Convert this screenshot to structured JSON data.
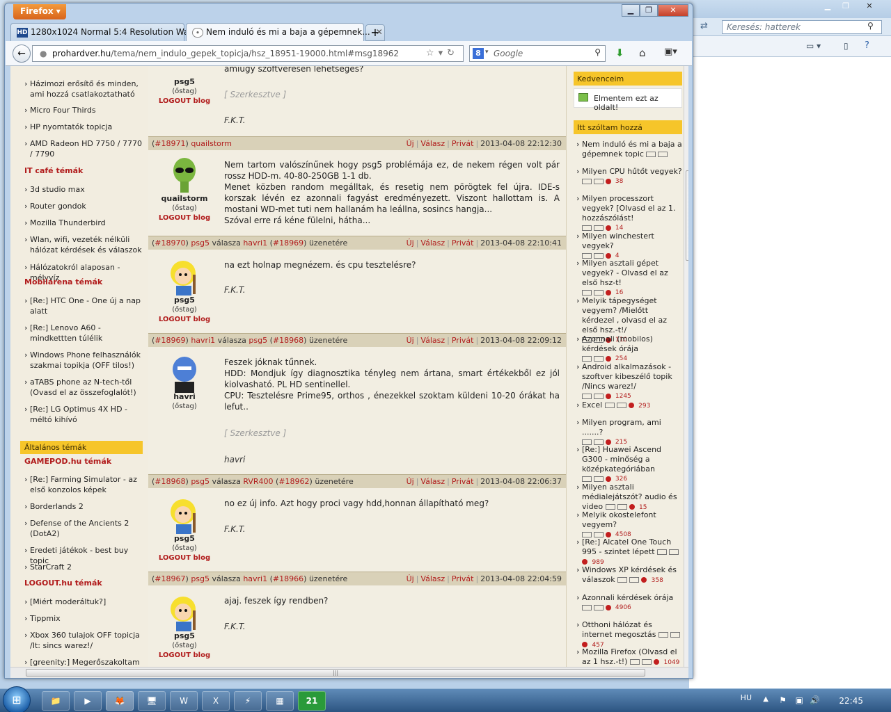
{
  "browser": {
    "firefox_button": "Firefox",
    "tabs": [
      {
        "label": "1280x1024 Normal 5:4 Resolution Wal...",
        "icon": "HD"
      },
      {
        "label": "Nem induló és mi a baja a gépemnek...",
        "icon": "•"
      }
    ],
    "url_domain": "prohardver.hu",
    "url_path": "/tema/nem_indulo_gepek_topicja/hsz_18951-19000.html#msg18962",
    "search_placeholder": "Google",
    "google_letter": "8"
  },
  "background_window": {
    "search_placeholder": "Keresés: hatterek"
  },
  "left_sidebar": {
    "top_items": [
      "Házimozi erősítő és minden, ami hozzá csatlakoztatható",
      "Micro Four Thirds",
      "HP nyomtatók topicja",
      "AMD Radeon HD 7750 / 7770 / 7790"
    ],
    "itcafe_head": "IT café témák",
    "itcafe_items": [
      "3d studio max",
      "Router gondok",
      "Mozilla Thunderbird",
      "Wlan, wifi, vezeték nélküli hálózat kérdések és válaszok",
      "Hálózatokról alaposan - mélyvíz"
    ],
    "mobilarena_head": "Mobilarena témák",
    "mobilarena_items": [
      "[Re:] HTC One - One új a nap alatt",
      "[Re:] Lenovo A60 - mindkettten túlélik",
      "Windows Phone felhasználók szakmai topikja (OFF tilos!)",
      "aTABS phone az N-tech-től (Ovasd el az összefoglalót!)",
      "[Re:] LG Optimus 4X HD - méltó kihívó"
    ],
    "general_box": "Általános témák",
    "gamepod_head": "GAMEPOD.hu témák",
    "gamepod_items": [
      "[Re:] Farming Simulator - az első konzolos képek",
      "Borderlands 2",
      "Defense of the Ancients 2 (DotA2)",
      "Eredeti játékok - best buy topic",
      "StarCraft 2"
    ],
    "logout_head": "LOGOUT.hu témák",
    "logout_items": [
      "[Miért moderáltuk?]",
      "Tippmix",
      "Xbox 360 tulajok OFF topicja /It: sincs warez!/",
      "[greenity:] Megerőszakoltam a"
    ]
  },
  "posts": [
    {
      "partial_top": "amiúgy szoftveresen lehetséges?",
      "edit_note": "[ Szerkesztve ]",
      "signature": "F.K.T.",
      "author": "psg5",
      "status": "(őstag)",
      "links": "LOGOUT blog"
    },
    {
      "id": "#18971",
      "author": "quailstorm",
      "reply_text": "",
      "actions": [
        "Új",
        "Válasz",
        "Privát"
      ],
      "timestamp": "2013-04-08 22:12:30",
      "status": "(őstag)",
      "links": "LOGOUT blog",
      "body": "Nem tartom valószínűnek hogy psg5 problémája ez, de nekem régen volt pár rossz HDD-m. 40-80-250GB 1-1 db.\nMenet közben random megálltak, és resetig nem pörögtek fel újra. IDE-s korszak lévén ez azonnali fagyást eredményezett. Viszont hallottam is. A mostani WD-met tuti nem hallanám ha leállna, sosincs hangja...\nSzóval erre rá kéne fülelni, hátha..."
    },
    {
      "id": "#18970",
      "author": "psg5",
      "reply_word": "válasza",
      "reply_to": "havri1",
      "reply_id": "#18969",
      "reply_suffix": "üzenetére",
      "actions": [
        "Új",
        "Válasz",
        "Privát"
      ],
      "timestamp": "2013-04-08 22:10:41",
      "status": "(őstag)",
      "links": "LOGOUT blog",
      "body": "na ezt holnap megnézem. és cpu tesztelésre?",
      "signature": "F.K.T."
    },
    {
      "id": "#18969",
      "author": "havri1",
      "reply_word": "válasza",
      "reply_to": "psg5",
      "reply_id": "#18968",
      "reply_suffix": "üzenetére",
      "actions": [
        "Új",
        "Válasz",
        "Privát"
      ],
      "timestamp": "2013-04-08 22:09:12",
      "display_name": "havri",
      "status": "(őstag)",
      "body": "Feszek jóknak tűnnek.\nHDD: Mondjuk így diagnosztika tényleg nem ártana, smart értékekből ez jól kiolvasható. PL HD sentinellel.\nCPU: Tesztelésre Prime95, orthos , énezekkel szoktam küldeni 10-20 órákat ha lefut..",
      "edit_note": "[ Szerkesztve ]",
      "signature": "havri"
    },
    {
      "id": "#18968",
      "author": "psg5",
      "reply_word": "válasza",
      "reply_to": "RVR400",
      "reply_id": "#18962",
      "reply_suffix": "üzenetére",
      "actions": [
        "Új",
        "Válasz",
        "Privát"
      ],
      "timestamp": "2013-04-08 22:06:37",
      "status": "(őstag)",
      "links": "LOGOUT blog",
      "body": "no ez új info. Azt hogy proci vagy hdd,honnan állapítható meg?",
      "signature": "F.K.T."
    },
    {
      "id": "#18967",
      "author": "psg5",
      "reply_word": "válasza",
      "reply_to": "havri1",
      "reply_id": "#18966",
      "reply_suffix": "üzenetére",
      "actions": [
        "Új",
        "Válasz",
        "Privát"
      ],
      "timestamp": "2013-04-08 22:04:59",
      "status": "(őstag)",
      "links": "LOGOUT blog",
      "body": "ajaj. feszek így rendben?",
      "signature": "F.K.T."
    }
  ],
  "right_sidebar": {
    "fav_box": "Kedvenceim",
    "fav_item": "Elmentem ezt az oldalt!",
    "topics_box": "Itt szóltam hozzá",
    "items": [
      {
        "title": "Nem induló és mi a baja a gépemnek topic",
        "count": ""
      },
      {
        "title": "Milyen CPU hűtőt vegyek?",
        "count": "38"
      },
      {
        "title": "Milyen processzort vegyek? [Olvasd el az 1. hozzászólást!",
        "count": "14"
      },
      {
        "title": "Milyen winchestert vegyek?",
        "count": "4"
      },
      {
        "title": "Milyen asztali gépet vegyek? - Olvasd el az első hsz-t!",
        "count": "16"
      },
      {
        "title": "Melyik tápegységet vegyem? /Mielőtt kérdezel , olvasd el az első hsz.-t!/",
        "count": "110"
      },
      {
        "title": "Azonnali (mobilos) kérdések órája",
        "count": "254"
      },
      {
        "title": "Android alkalmazások - szoftver kibeszélő topik /Nincs warez!/",
        "count": "1245"
      },
      {
        "title": "Excel",
        "count": "293"
      },
      {
        "title": "Milyen program, ami .......?",
        "count": "215"
      },
      {
        "title": "[Re:] Huawei Ascend G300 - minőség a középkategóriában",
        "count": "326"
      },
      {
        "title": "Milyen asztali médialejátszót? audio és video",
        "count": "15"
      },
      {
        "title": "Melyik okostelefont vegyem?",
        "count": "4508"
      },
      {
        "title": "[Re:] Alcatel One Touch 995 - szintet lépett",
        "count": "989"
      },
      {
        "title": "Windows XP kérdések és válaszok",
        "count": "358"
      },
      {
        "title": "Azonnali kérdések órája",
        "count": "4906"
      },
      {
        "title": "Otthoni hálózat és internet megosztás",
        "count": "457"
      },
      {
        "title": "Mozilla Firefox (Olvasd el az 1 hsz.-t!)",
        "count": "1049"
      }
    ]
  },
  "taskbar": {
    "lang": "HU",
    "clock": "22:45",
    "apps": [
      "📁",
      "▶",
      "🦊",
      "🖥",
      "W",
      "X",
      "⚡",
      "▦",
      "21"
    ]
  }
}
